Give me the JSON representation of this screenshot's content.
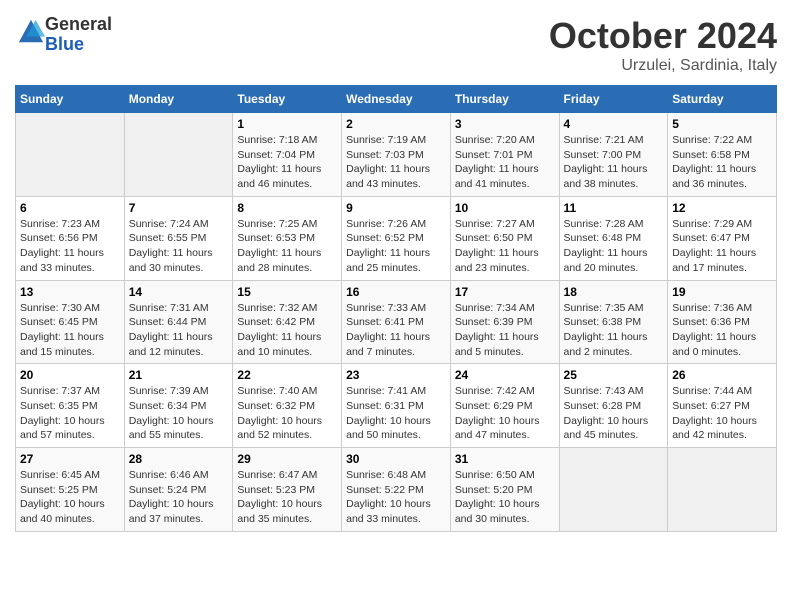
{
  "header": {
    "logo_line1": "General",
    "logo_line2": "Blue",
    "month": "October 2024",
    "location": "Urzulei, Sardinia, Italy"
  },
  "weekdays": [
    "Sunday",
    "Monday",
    "Tuesday",
    "Wednesday",
    "Thursday",
    "Friday",
    "Saturday"
  ],
  "weeks": [
    [
      {
        "day": "",
        "info": ""
      },
      {
        "day": "",
        "info": ""
      },
      {
        "day": "1",
        "info": "Sunrise: 7:18 AM\nSunset: 7:04 PM\nDaylight: 11 hours and 46 minutes."
      },
      {
        "day": "2",
        "info": "Sunrise: 7:19 AM\nSunset: 7:03 PM\nDaylight: 11 hours and 43 minutes."
      },
      {
        "day": "3",
        "info": "Sunrise: 7:20 AM\nSunset: 7:01 PM\nDaylight: 11 hours and 41 minutes."
      },
      {
        "day": "4",
        "info": "Sunrise: 7:21 AM\nSunset: 7:00 PM\nDaylight: 11 hours and 38 minutes."
      },
      {
        "day": "5",
        "info": "Sunrise: 7:22 AM\nSunset: 6:58 PM\nDaylight: 11 hours and 36 minutes."
      }
    ],
    [
      {
        "day": "6",
        "info": "Sunrise: 7:23 AM\nSunset: 6:56 PM\nDaylight: 11 hours and 33 minutes."
      },
      {
        "day": "7",
        "info": "Sunrise: 7:24 AM\nSunset: 6:55 PM\nDaylight: 11 hours and 30 minutes."
      },
      {
        "day": "8",
        "info": "Sunrise: 7:25 AM\nSunset: 6:53 PM\nDaylight: 11 hours and 28 minutes."
      },
      {
        "day": "9",
        "info": "Sunrise: 7:26 AM\nSunset: 6:52 PM\nDaylight: 11 hours and 25 minutes."
      },
      {
        "day": "10",
        "info": "Sunrise: 7:27 AM\nSunset: 6:50 PM\nDaylight: 11 hours and 23 minutes."
      },
      {
        "day": "11",
        "info": "Sunrise: 7:28 AM\nSunset: 6:48 PM\nDaylight: 11 hours and 20 minutes."
      },
      {
        "day": "12",
        "info": "Sunrise: 7:29 AM\nSunset: 6:47 PM\nDaylight: 11 hours and 17 minutes."
      }
    ],
    [
      {
        "day": "13",
        "info": "Sunrise: 7:30 AM\nSunset: 6:45 PM\nDaylight: 11 hours and 15 minutes."
      },
      {
        "day": "14",
        "info": "Sunrise: 7:31 AM\nSunset: 6:44 PM\nDaylight: 11 hours and 12 minutes."
      },
      {
        "day": "15",
        "info": "Sunrise: 7:32 AM\nSunset: 6:42 PM\nDaylight: 11 hours and 10 minutes."
      },
      {
        "day": "16",
        "info": "Sunrise: 7:33 AM\nSunset: 6:41 PM\nDaylight: 11 hours and 7 minutes."
      },
      {
        "day": "17",
        "info": "Sunrise: 7:34 AM\nSunset: 6:39 PM\nDaylight: 11 hours and 5 minutes."
      },
      {
        "day": "18",
        "info": "Sunrise: 7:35 AM\nSunset: 6:38 PM\nDaylight: 11 hours and 2 minutes."
      },
      {
        "day": "19",
        "info": "Sunrise: 7:36 AM\nSunset: 6:36 PM\nDaylight: 11 hours and 0 minutes."
      }
    ],
    [
      {
        "day": "20",
        "info": "Sunrise: 7:37 AM\nSunset: 6:35 PM\nDaylight: 10 hours and 57 minutes."
      },
      {
        "day": "21",
        "info": "Sunrise: 7:39 AM\nSunset: 6:34 PM\nDaylight: 10 hours and 55 minutes."
      },
      {
        "day": "22",
        "info": "Sunrise: 7:40 AM\nSunset: 6:32 PM\nDaylight: 10 hours and 52 minutes."
      },
      {
        "day": "23",
        "info": "Sunrise: 7:41 AM\nSunset: 6:31 PM\nDaylight: 10 hours and 50 minutes."
      },
      {
        "day": "24",
        "info": "Sunrise: 7:42 AM\nSunset: 6:29 PM\nDaylight: 10 hours and 47 minutes."
      },
      {
        "day": "25",
        "info": "Sunrise: 7:43 AM\nSunset: 6:28 PM\nDaylight: 10 hours and 45 minutes."
      },
      {
        "day": "26",
        "info": "Sunrise: 7:44 AM\nSunset: 6:27 PM\nDaylight: 10 hours and 42 minutes."
      }
    ],
    [
      {
        "day": "27",
        "info": "Sunrise: 6:45 AM\nSunset: 5:25 PM\nDaylight: 10 hours and 40 minutes."
      },
      {
        "day": "28",
        "info": "Sunrise: 6:46 AM\nSunset: 5:24 PM\nDaylight: 10 hours and 37 minutes."
      },
      {
        "day": "29",
        "info": "Sunrise: 6:47 AM\nSunset: 5:23 PM\nDaylight: 10 hours and 35 minutes."
      },
      {
        "day": "30",
        "info": "Sunrise: 6:48 AM\nSunset: 5:22 PM\nDaylight: 10 hours and 33 minutes."
      },
      {
        "day": "31",
        "info": "Sunrise: 6:50 AM\nSunset: 5:20 PM\nDaylight: 10 hours and 30 minutes."
      },
      {
        "day": "",
        "info": ""
      },
      {
        "day": "",
        "info": ""
      }
    ]
  ]
}
